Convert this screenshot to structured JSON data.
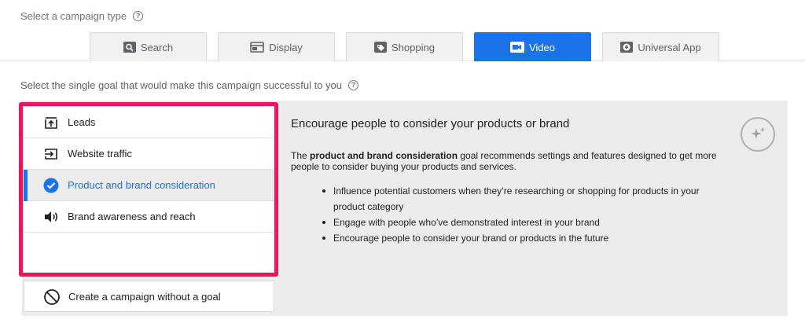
{
  "campaign_type": {
    "label": "Select a campaign type",
    "tabs": [
      {
        "label": "Search",
        "icon": "search-icon"
      },
      {
        "label": "Display",
        "icon": "display-icon"
      },
      {
        "label": "Shopping",
        "icon": "tag-icon"
      },
      {
        "label": "Video",
        "icon": "video-icon",
        "active": true
      },
      {
        "label": "Universal App",
        "icon": "download-icon"
      }
    ]
  },
  "goal": {
    "label": "Select the single goal that would make this campaign successful to you",
    "items": [
      {
        "label": "Leads",
        "icon": "upload-box-icon"
      },
      {
        "label": "Website traffic",
        "icon": "login-arrow-icon"
      },
      {
        "label": "Product and brand consideration",
        "icon": "check-circle-icon",
        "selected": true
      },
      {
        "label": "Brand awareness and reach",
        "icon": "speaker-icon"
      }
    ],
    "no_goal_label": "Create a campaign without a goal"
  },
  "detail": {
    "title": "Encourage people to consider your products or brand",
    "desc_prefix": "The ",
    "desc_bold": "product and brand consideration",
    "desc_suffix": " goal recommends settings and features designed to get more people to consider buying your products and services.",
    "bullets": [
      "Influence potential customers when they’re researching or shopping for products in your product category",
      "Engage with people who’ve demonstrated interest in your brand",
      "Encourage people to consider your brand or products in the future"
    ]
  },
  "colors": {
    "accent": "#1a73e8",
    "highlight": "#f0145a",
    "panel_bg": "#ececec"
  }
}
